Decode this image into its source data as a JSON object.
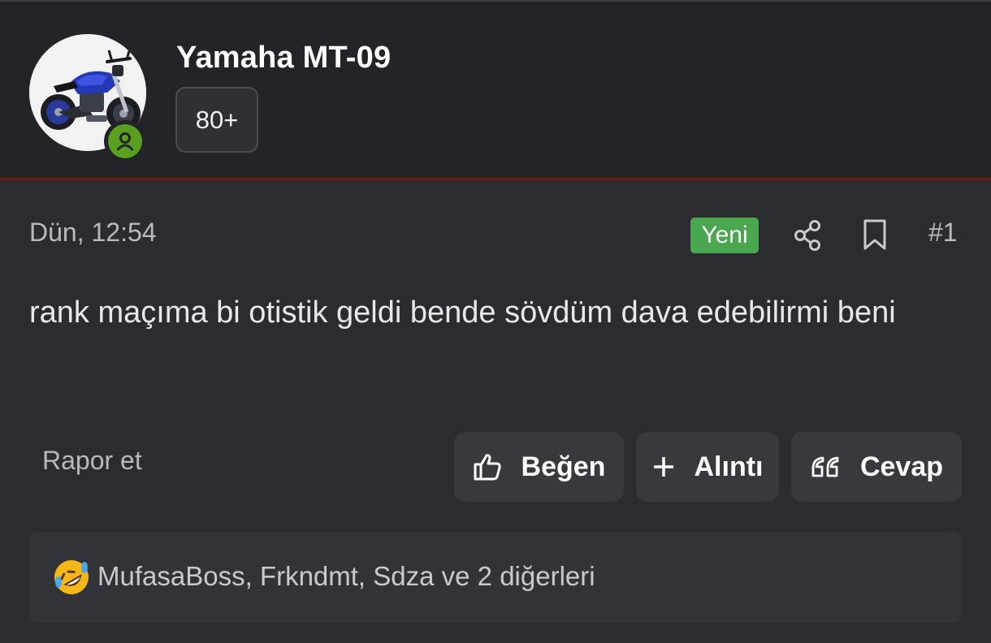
{
  "user": {
    "name": "Yamaha MT-09",
    "rank_badge": "80+",
    "avatar_icon": "motorcycle-avatar",
    "online_icon": "online-user-icon"
  },
  "post": {
    "date": "Dün, 12:54",
    "new_badge": "Yeni",
    "number": "#1",
    "body": "rank maçıma bi otistik geldi bende sövdüm dava edebilirmi beni"
  },
  "actions": {
    "report": "Rapor et",
    "like": "Beğen",
    "quote": "Alıntı",
    "reply": "Cevap"
  },
  "reactions": {
    "emoji": "rolling-on-floor-laughing-icon",
    "users": "MufasaBoss, Frkndmt, Sdza",
    "others": " ve 2 diğerleri"
  },
  "colors": {
    "background": "#2b2c2f",
    "header": "#232428",
    "accent_border": "#7a1618",
    "new_badge": "#4aa64f",
    "online": "#5aa020",
    "button": "#38393d"
  }
}
